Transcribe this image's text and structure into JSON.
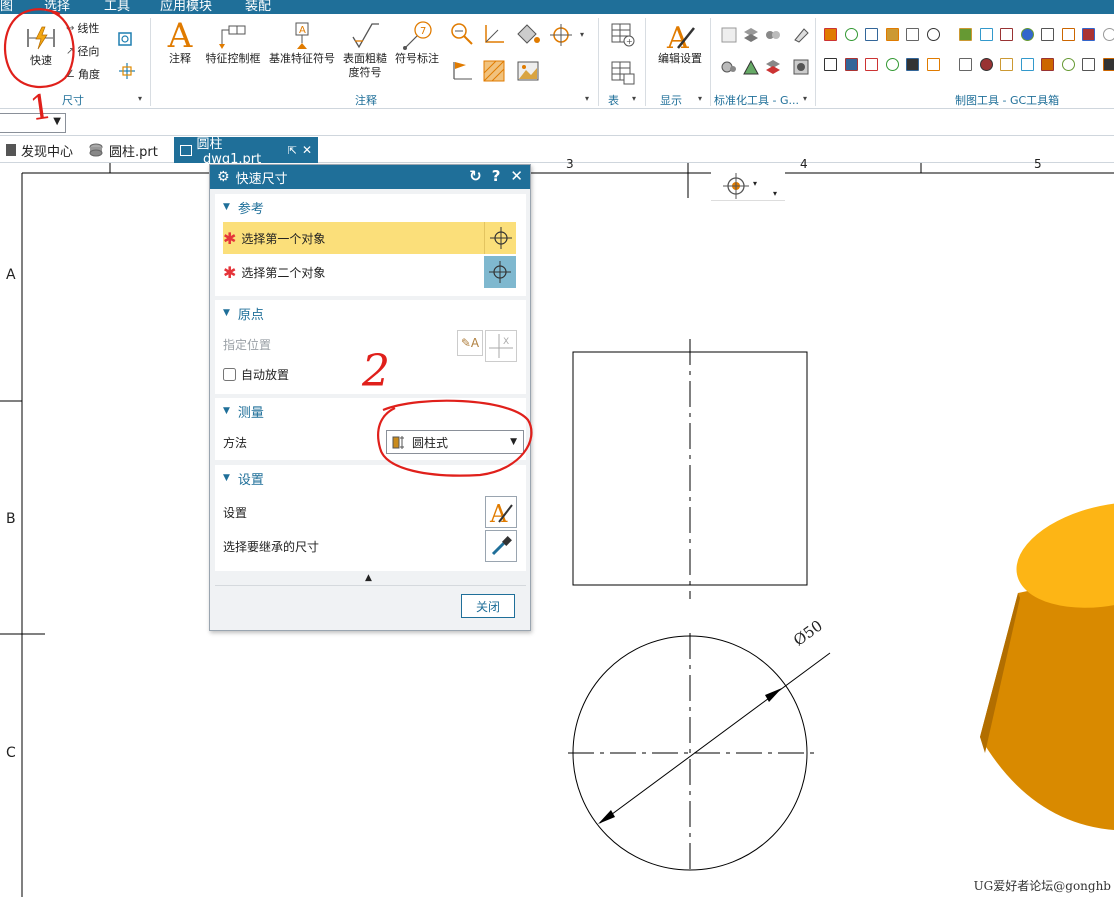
{
  "menu": [
    "图",
    "选择",
    "工具",
    "应用模块",
    "装配"
  ],
  "ribbon": {
    "dimension_group": {
      "label": "尺寸",
      "quick_label": "快速",
      "linear_label": "线性",
      "radial_label": "径向",
      "angle_label": "角度"
    },
    "annotation_group": {
      "label": "注释",
      "note_label": "注释",
      "feature_control_label": "特征控制框",
      "datum_label": "基准特征符号",
      "surface_label_1": "表面粗糙",
      "surface_label_2": "度符号",
      "symbol_label": "符号标注"
    },
    "table_group": {
      "label": "表"
    },
    "display_group": {
      "label": "显示",
      "edit_settings_label": "编辑设置"
    },
    "standard_group": {
      "label": "标准化工具 - G..."
    },
    "drafting_group": {
      "label": "制图工具 - GC工具箱"
    }
  },
  "tabs": [
    {
      "label": "发现中心"
    },
    {
      "label": "圆柱.prt"
    },
    {
      "label": "圆柱_dwg1.prt"
    }
  ],
  "dialog": {
    "title": "快速尺寸",
    "reference": {
      "header": "参考",
      "first_object": "选择第一个对象",
      "second_object": "选择第二个对象"
    },
    "origin": {
      "header": "原点",
      "specify_location": "指定位置",
      "auto_place": "自动放置"
    },
    "measurement": {
      "header": "测量",
      "method_label": "方法",
      "method_value": "圆柱式"
    },
    "settings": {
      "header": "设置",
      "settings_label": "设置",
      "inherit_label": "选择要继承的尺寸"
    },
    "close_label": "关闭"
  },
  "drawing": {
    "border_rows": [
      "A",
      "B",
      "C"
    ],
    "border_cols": [
      "3",
      "4",
      "5"
    ],
    "dimension_text": "Ø50"
  },
  "annotations": [
    "1",
    "2"
  ],
  "watermark": "UG爱好者论坛@gonghb",
  "colors": {
    "accent": "#1f6f99",
    "selection_highlight": "#fbdf7a",
    "required_star": "#e5343a",
    "cylinder_top": "#fdb515",
    "cylinder_side": "#d98a00",
    "markup_red": "#e0201b"
  }
}
